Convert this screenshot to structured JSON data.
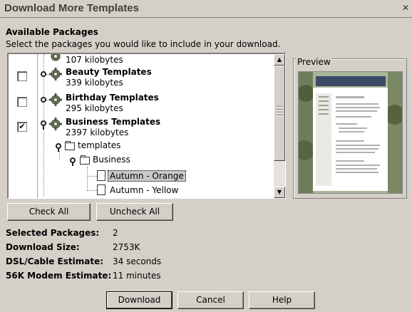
{
  "window": {
    "title": "Download More Templates"
  },
  "header": {
    "heading": "Available Packages",
    "instruction": "Select the packages you would like to include in your download."
  },
  "packages": [
    {
      "title": "",
      "size": "107 kilobytes",
      "checked": false
    },
    {
      "title": "Beauty Templates",
      "size": "339 kilobytes",
      "checked": false
    },
    {
      "title": "Birthday Templates",
      "size": "295 kilobytes",
      "checked": false
    },
    {
      "title": "Business Templates",
      "size": "2397 kilobytes",
      "checked": true,
      "check_mark": "✔"
    }
  ],
  "tree": {
    "folder1": "templates",
    "folder2": "Business",
    "items": [
      "Autumn - Orange",
      "Autumn - Yellow"
    ]
  },
  "preview": {
    "label": "Preview",
    "company_text": "Your Company Name Here"
  },
  "buttons": {
    "check_all": "Check All",
    "uncheck_all": "Uncheck All",
    "download": "Download",
    "cancel": "Cancel",
    "help": "Help"
  },
  "stats": {
    "selected_packages_label": "Selected Packages:",
    "selected_packages_value": "2",
    "download_size_label": "Download Size:",
    "download_size_value": "2753K",
    "dsl_label": "DSL/Cable Estimate:",
    "dsl_value": "34 seconds",
    "modem_label": "56K Modem Estimate:",
    "modem_value": "11 minutes"
  },
  "icons": {
    "close": "close-icon",
    "gear": "gear-icon",
    "folder": "folder-icon",
    "document": "document-icon",
    "scroll_up": "scroll-up-icon",
    "scroll_down": "scroll-down-icon"
  }
}
